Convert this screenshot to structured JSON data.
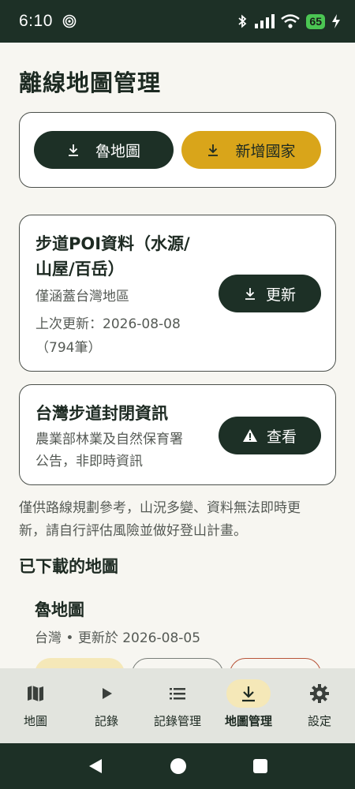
{
  "status_bar": {
    "time": "6:10",
    "battery_level": "65",
    "icons": [
      "sync-icon",
      "bluetooth-icon",
      "signal-icon",
      "wifi-icon",
      "battery-charging-icon"
    ]
  },
  "page": {
    "title": "離線地圖管理"
  },
  "top_actions": {
    "download_label": "魯地圖",
    "add_country_label": "新增國家"
  },
  "poi_card": {
    "title_line1": "步道POI資料（水源/",
    "title_line2": "山屋/百岳）",
    "coverage": "僅涵蓋台灣地區",
    "updated_line1": "上次更新：2026-08-08",
    "updated_line2": "（794筆）",
    "update_button": "更新"
  },
  "closure_card": {
    "title": "台灣步道封閉資訊",
    "desc_line1": "農業部林業及自然保育署",
    "desc_line2": "公告，非即時資訊",
    "view_button": "查看"
  },
  "notice": {
    "line1": "僅供路線規劃參考，山況多變、資料無法即時更",
    "line2": "新，請自行評估風險並做好登山計畫。"
  },
  "downloaded": {
    "section_title": "已下載的地圖",
    "map_name": "魯地圖",
    "map_meta": "台灣 • 更新於 2026-08-05"
  },
  "bottom_nav": {
    "items": [
      {
        "label": "地圖",
        "icon": "map-icon"
      },
      {
        "label": "記錄",
        "icon": "play-icon"
      },
      {
        "label": "記錄管理",
        "icon": "list-icon"
      },
      {
        "label": "地圖管理",
        "icon": "download-icon",
        "active": true
      },
      {
        "label": "設定",
        "icon": "gear-icon"
      }
    ]
  },
  "colors": {
    "primary_dark": "#1d3026",
    "accent_gold": "#d9a51a",
    "active_pill": "#f5e8b8"
  }
}
